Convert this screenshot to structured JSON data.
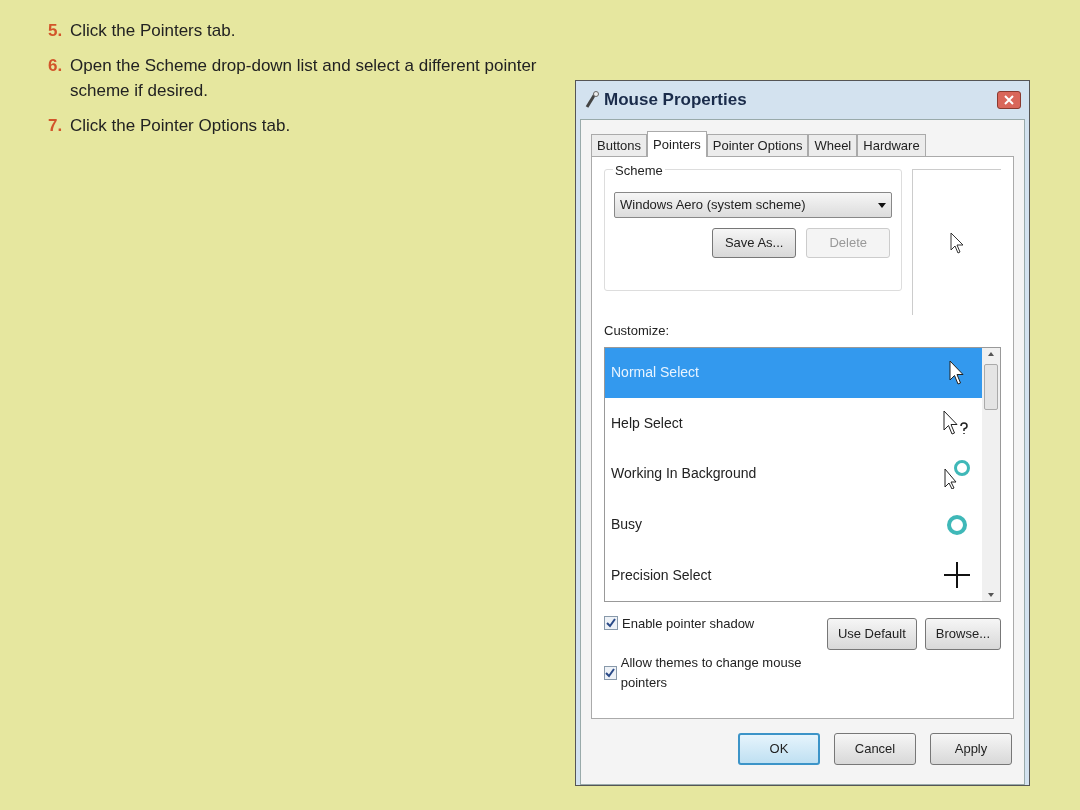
{
  "steps": [
    {
      "number": "5.",
      "text": "Click the Pointers tab."
    },
    {
      "number": "6.",
      "text": "Open the Scheme drop-down list and select a different pointer scheme if desired."
    },
    {
      "number": "7.",
      "text": "Click the Pointer Options tab."
    }
  ],
  "window": {
    "title": "Mouse Properties"
  },
  "tabs": [
    {
      "label": "Buttons",
      "selected": false
    },
    {
      "label": "Pointers",
      "selected": true
    },
    {
      "label": "Pointer Options",
      "selected": false
    },
    {
      "label": "Wheel",
      "selected": false
    },
    {
      "label": "Hardware",
      "selected": false
    }
  ],
  "scheme": {
    "label": "Scheme",
    "value": "Windows Aero (system scheme)",
    "buttons": [
      {
        "label": "Save As...",
        "disabled": false
      },
      {
        "label": "Delete",
        "disabled": true
      }
    ]
  },
  "customize": {
    "label": "Customize:",
    "items": [
      {
        "label": "Normal Select",
        "kind": "arrow",
        "selected": true
      },
      {
        "label": "Help Select",
        "kind": "help",
        "selected": false
      },
      {
        "label": "Working In Background",
        "kind": "working",
        "selected": false
      },
      {
        "label": "Busy",
        "kind": "busy",
        "selected": false
      },
      {
        "label": "Precision Select",
        "kind": "cross",
        "selected": false
      }
    ]
  },
  "options": [
    {
      "label": "Enable pointer shadow",
      "checked": true
    },
    {
      "label": "Allow themes to change mouse pointers",
      "checked": true
    }
  ],
  "side_buttons": [
    "Use Default",
    "Browse..."
  ],
  "footer_buttons": [
    {
      "label": "OK",
      "default": true
    },
    {
      "label": "Cancel",
      "default": false
    },
    {
      "label": "Apply",
      "default": false
    }
  ]
}
